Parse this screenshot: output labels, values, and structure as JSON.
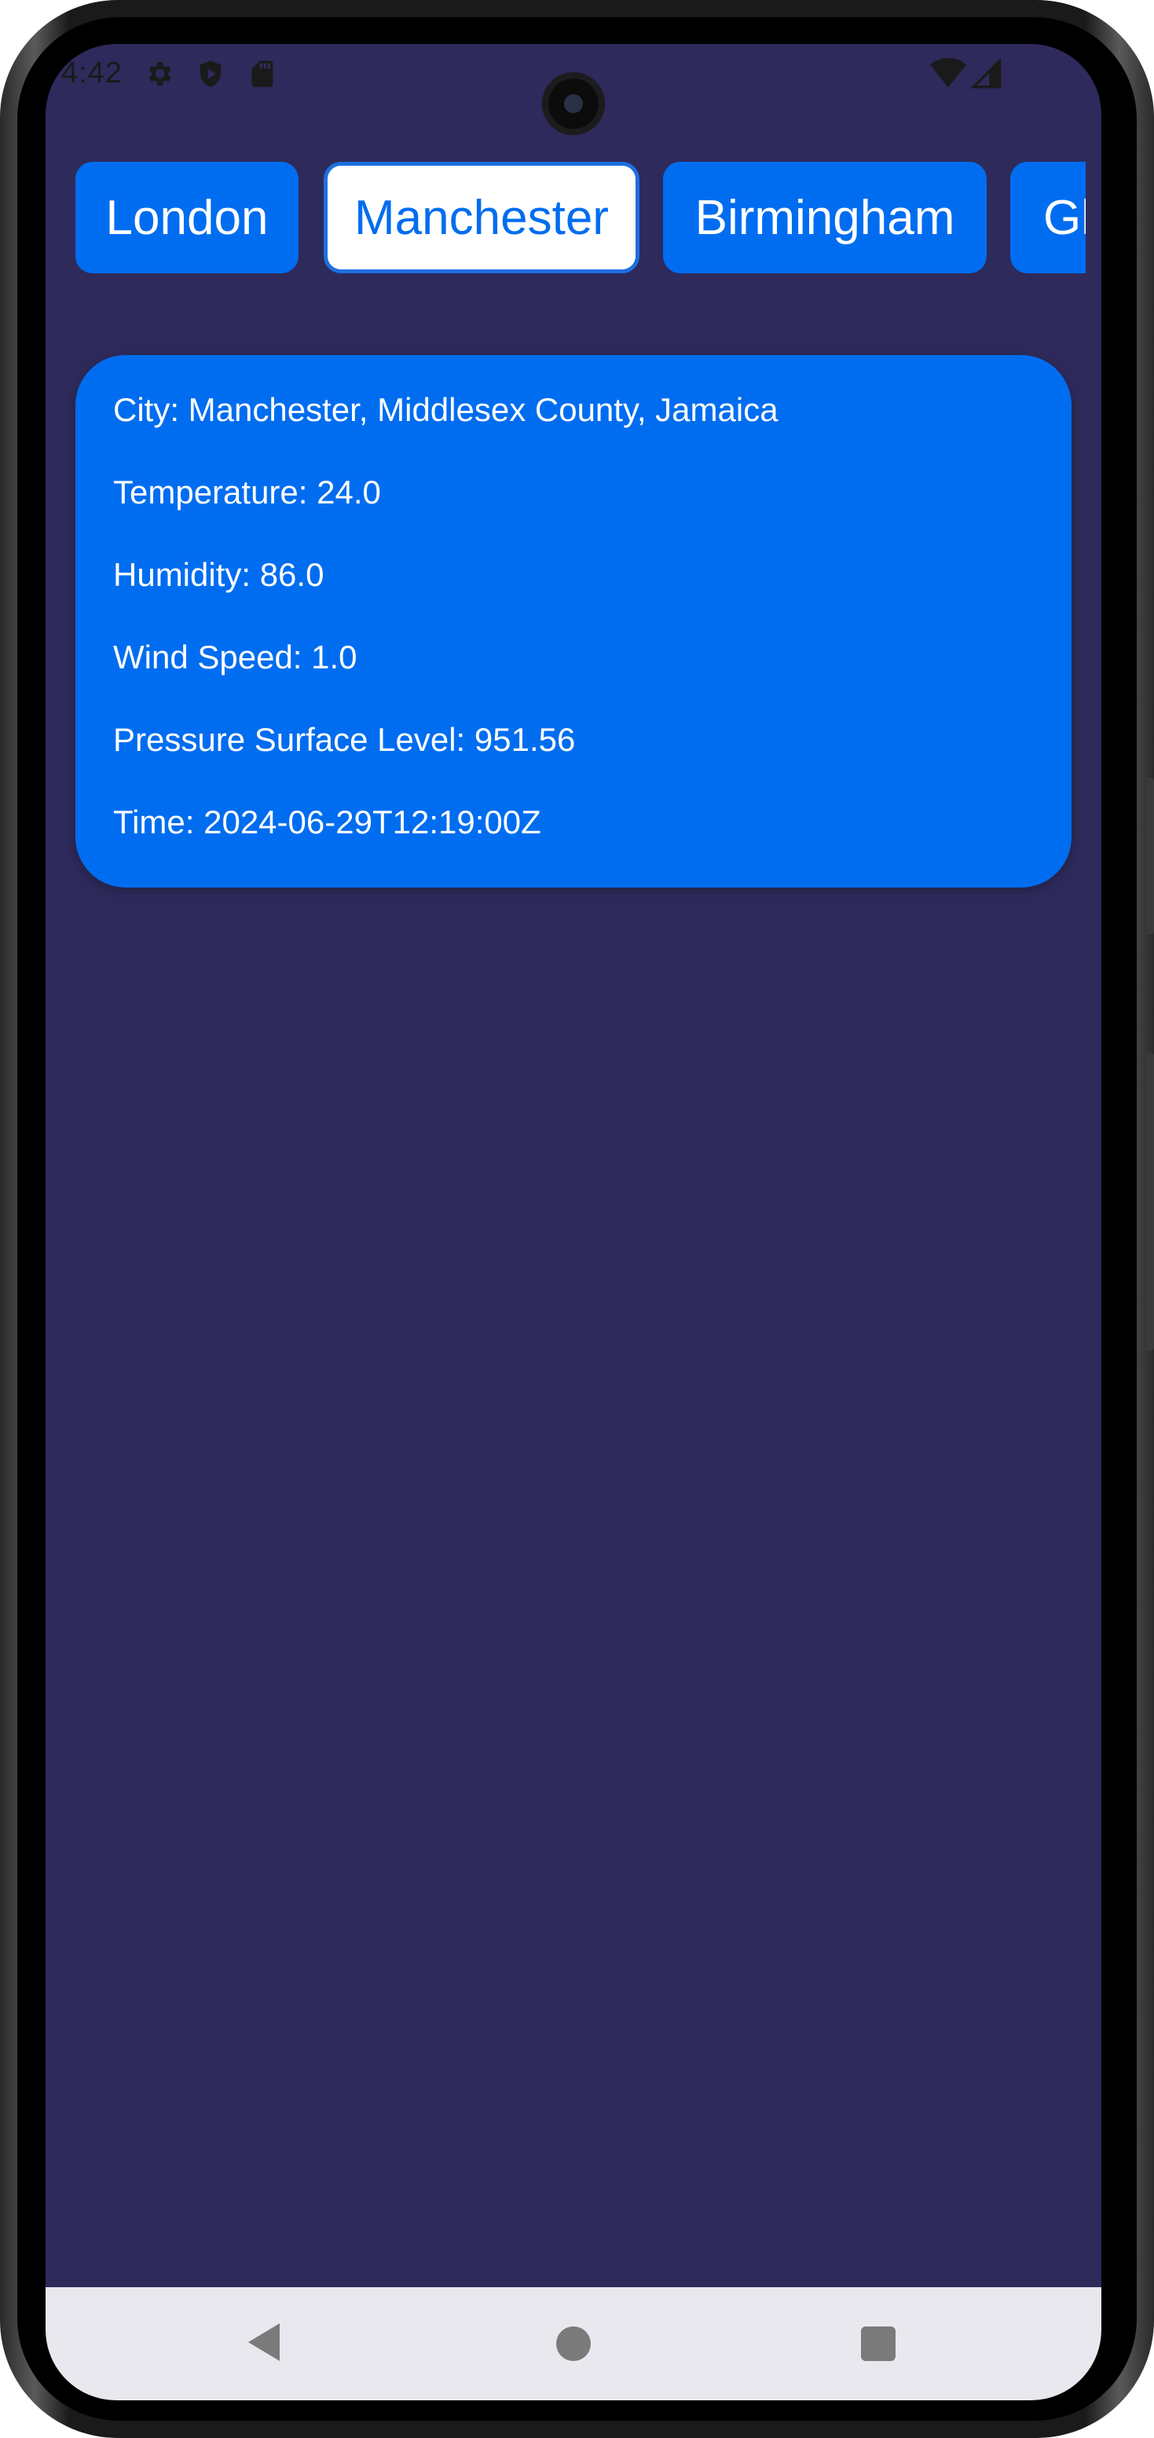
{
  "status_bar": {
    "time": "4:42",
    "left_icons": [
      "gear-icon",
      "shield-icon",
      "sd-card-icon"
    ],
    "right_icons": [
      "wifi-icon",
      "signal-icon"
    ]
  },
  "tabs": [
    {
      "label": "London",
      "selected": false
    },
    {
      "label": "Manchester",
      "selected": true
    },
    {
      "label": "Birmingham",
      "selected": false
    },
    {
      "label": "Gl",
      "selected": false
    }
  ],
  "weather_card": {
    "city": "City: Manchester, Middlesex County, Jamaica",
    "temperature": "Temperature: 24.0",
    "humidity": "Humidity: 86.0",
    "wind_speed": "Wind Speed: 1.0",
    "pressure": "Pressure Surface Level: 951.56",
    "time": "Time: 2024-06-29T12:19:00Z"
  },
  "navigation_bar": {
    "buttons": [
      "back-icon",
      "home-icon",
      "recents-icon"
    ]
  },
  "colors": {
    "background": "#2e2a5b",
    "accent": "#006df0",
    "selected_tab_bg": "#ffffff",
    "nav_bar_bg": "#e9e8ee"
  }
}
